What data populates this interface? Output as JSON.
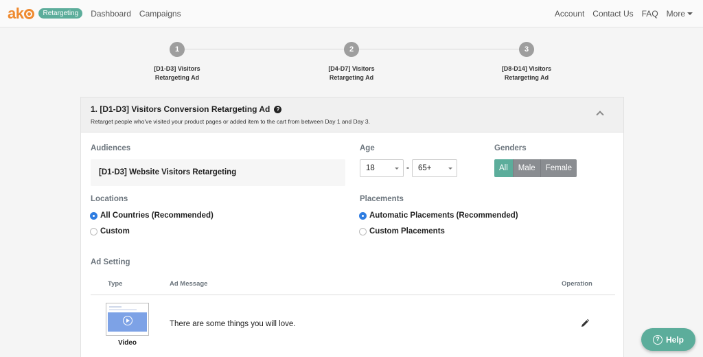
{
  "navbar": {
    "logo": "ak",
    "badge": "Retargeting",
    "links": [
      "Dashboard",
      "Campaigns"
    ],
    "right_links": [
      "Account",
      "Contact Us",
      "FAQ"
    ],
    "more": "More"
  },
  "stepper": {
    "steps": [
      {
        "number": "1",
        "line1": "[D1-D3] Visitors",
        "line2": "Retargeting Ad"
      },
      {
        "number": "2",
        "line1": "[D4-D7] Visitors",
        "line2": "Retargeting Ad"
      },
      {
        "number": "3",
        "line1": "[D8-D14] Visitors",
        "line2": "Retargeting Ad"
      }
    ]
  },
  "panel": {
    "title": "1. [D1-D3] Visitors Conversion Retargeting Ad",
    "subtitle": "Retarget people who've visited your product pages or added item to the cart from between Day 1 and Day 3.",
    "audiences_label": "Audiences",
    "audience_value": "[D1-D3] Website Visitors Retargeting",
    "age_label": "Age",
    "age_min": "18",
    "age_separator": "-",
    "age_max": "65+",
    "genders_label": "Genders",
    "genders": [
      "All",
      "Male",
      "Female"
    ],
    "genders_selected": "All",
    "locations_label": "Locations",
    "locations": [
      {
        "label": "All Countries (Recommended)",
        "checked": true
      },
      {
        "label": "Custom",
        "checked": false
      }
    ],
    "placements_label": "Placements",
    "placements": [
      {
        "label": "Automatic Placements (Recommended)",
        "checked": true
      },
      {
        "label": "Custom Placements",
        "checked": false
      }
    ],
    "ad_setting_label": "Ad Setting",
    "table_headers": {
      "type": "Type",
      "message": "Ad Message",
      "operation": "Operation"
    },
    "row": {
      "type": "Video",
      "message": "There are some things you will love."
    }
  },
  "help": {
    "label": "Help"
  },
  "colors": {
    "brand": "#ef8a2f",
    "accent": "#5cad9b",
    "radio": "#2f7de1"
  }
}
